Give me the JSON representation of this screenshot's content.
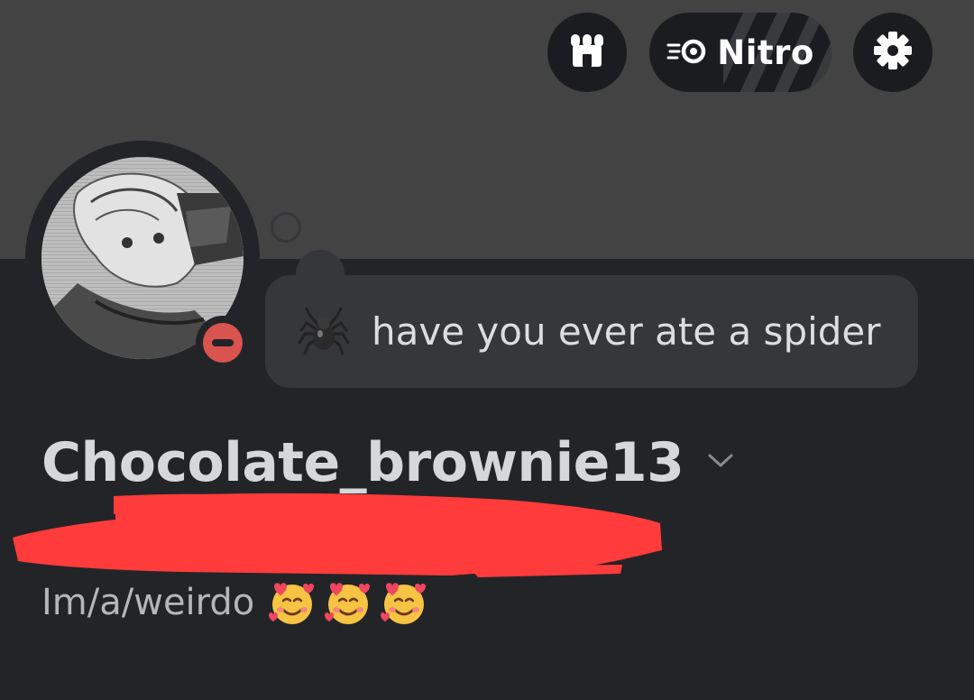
{
  "toolbar": {
    "shop_icon": "shop-icon",
    "nitro_label": "Nitro",
    "nitro_icon": "nitro-icon",
    "settings_icon": "gear-icon"
  },
  "profile": {
    "username": "Chocolate_brownie13",
    "username_dropdown_icon": "chevron-down-icon",
    "status_indicator": "do-not-disturb",
    "status_color": "#d9534f",
    "custom_status": {
      "emoji": "spider-icon",
      "text": "have you ever ate a spider"
    },
    "bio": {
      "text": "Im/a/weirdo",
      "emojis": [
        "smiling-face-with-hearts-icon",
        "smiling-face-with-hearts-icon",
        "smiling-face-with-hearts-icon"
      ]
    }
  },
  "colors": {
    "banner": "#434343",
    "background": "#232428",
    "bubble": "#36373b",
    "redaction": "#ff3b3b"
  }
}
